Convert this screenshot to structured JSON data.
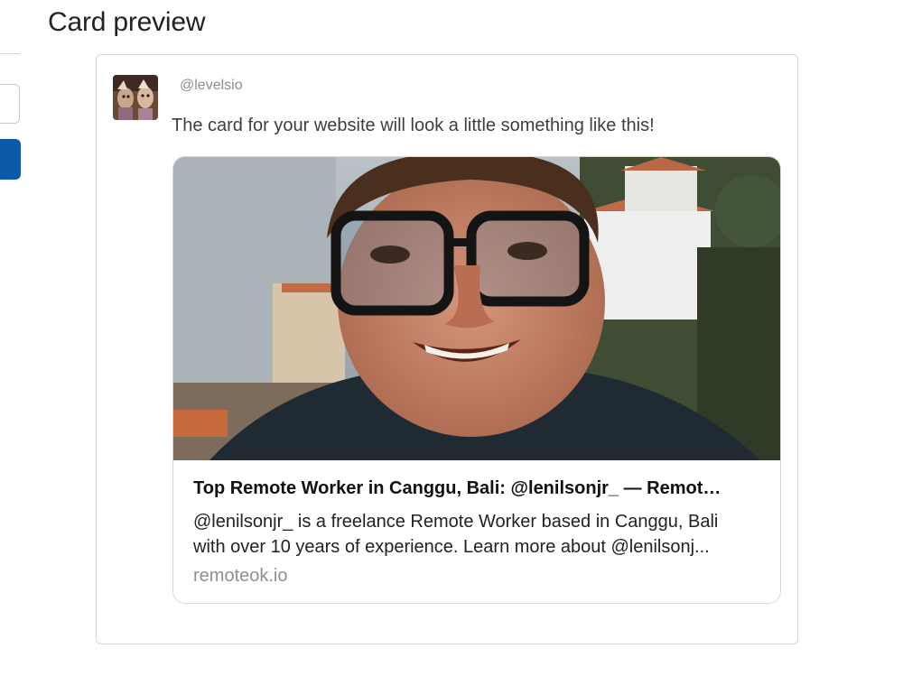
{
  "header": {
    "title": "Card preview"
  },
  "tweet": {
    "handle": "@levelsio",
    "text": "The card for your website will look a little something like this!"
  },
  "card": {
    "title": "Top Remote Worker in Canggu, Bali: @lenilsonjr_ — Remot…",
    "description_line1": "@lenilsonjr_ is a freelance Remote Worker based in Canggu, Bali",
    "description_line2": "with over 10 years of experience. Learn more about @lenilsonj...",
    "domain": "remoteok.io"
  },
  "colors": {
    "primary_button": "#0b5aa8",
    "muted_text": "#8a9197",
    "border": "#cfd4d9"
  }
}
